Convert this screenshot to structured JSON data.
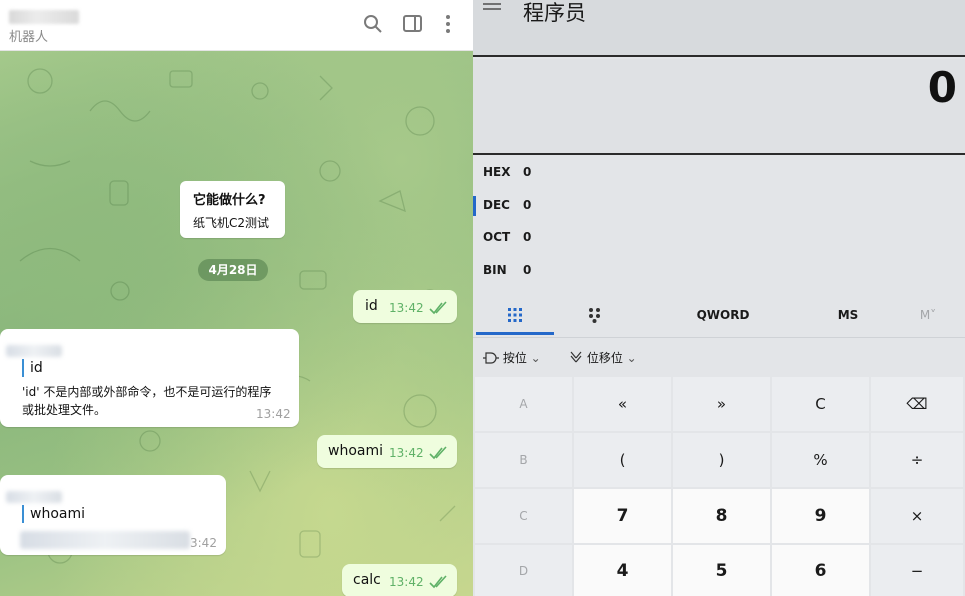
{
  "telegram": {
    "chat_subtitle": "机器人",
    "icons": [
      "search-icon",
      "sidebar-toggle-icon",
      "more-vertical-icon"
    ],
    "service_card": {
      "title": "它能做什么?",
      "text": "纸飞机C2测试"
    },
    "date_label": "4月28日",
    "messages": [
      {
        "text": "id",
        "time": "13:42"
      },
      {
        "quote": "id",
        "text": "'id' 不是内部或外部命令，也不是可运行的程序",
        "text2": "或批处理文件。",
        "time": "13:42"
      },
      {
        "text": "whoami",
        "time": "13:42"
      },
      {
        "quote": "whoami",
        "time": "3:42"
      },
      {
        "text": "calc",
        "time": "13:42"
      }
    ]
  },
  "calculator": {
    "title": "程序员",
    "display": "0",
    "radix": [
      {
        "label": "HEX",
        "value": "0"
      },
      {
        "label": "DEC",
        "value": "0"
      },
      {
        "label": "OCT",
        "value": "0"
      },
      {
        "label": "BIN",
        "value": "0"
      }
    ],
    "tabs": {
      "word_size": "QWORD",
      "ms": "MS",
      "mplus": "M˅"
    },
    "bitwise_label": "按位",
    "bitshift_label": "位移位",
    "keys": [
      [
        "A",
        "«",
        "»",
        "C",
        "⌫"
      ],
      [
        "B",
        "(",
        ")",
        "%",
        "÷"
      ],
      [
        "C",
        "7",
        "8",
        "9",
        "×"
      ],
      [
        "D",
        "4",
        "5",
        "6",
        "−"
      ]
    ],
    "colors": {
      "accent": "#2468c9",
      "outgoing_bubble": "#effdde",
      "check": "#5fb167"
    }
  }
}
